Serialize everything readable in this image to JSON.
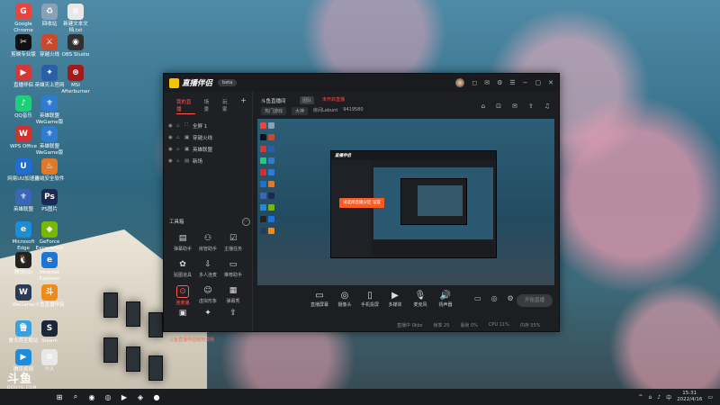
{
  "desktop": {
    "icons": [
      {
        "label": "Google Chrome",
        "color": "#e8453c",
        "glyph": "G"
      },
      {
        "label": "回收站",
        "color": "#8aa0b4",
        "glyph": "♻"
      },
      {
        "label": "新建文本文档.txt",
        "color": "#e8e8e8",
        "glyph": "≡"
      },
      {
        "label": "剪映专业版",
        "color": "#111111",
        "glyph": "✂"
      },
      {
        "label": "穿越火线",
        "color": "#c94a2a",
        "glyph": "⚔"
      },
      {
        "label": "OBS Studio",
        "color": "#303030",
        "glyph": "◉"
      },
      {
        "label": "直播伴侣",
        "color": "#d23a3a",
        "glyph": "▶"
      },
      {
        "label": "英雄天上官网",
        "color": "#2a5fa8",
        "glyph": "✦"
      },
      {
        "label": "MSI Afterburner",
        "color": "#a31a1a",
        "glyph": "⊛"
      },
      {
        "label": "QQ音乐",
        "color": "#1ecf7a",
        "glyph": "♪"
      },
      {
        "label": "英雄联盟 WeGame版",
        "color": "#2f7bd0",
        "glyph": "⚜"
      },
      {
        "label": "WPS Office",
        "color": "#d0312d",
        "glyph": "W"
      },
      {
        "label": "英雄联盟 WeGame版",
        "color": "#2f7bd0",
        "glyph": "⚜"
      },
      {
        "label": "网易UU加速器",
        "color": "#1f6dd6",
        "glyph": "U"
      },
      {
        "label": "火绒安全软件",
        "color": "#e07a2a",
        "glyph": "♨"
      },
      {
        "label": "英雄联盟",
        "color": "#3a66b8",
        "glyph": "⚜"
      },
      {
        "label": "PS图片",
        "color": "#1a2a55",
        "glyph": "Ps"
      },
      {
        "label": "Microsoft Edge",
        "color": "#1a8fd8",
        "glyph": "e"
      },
      {
        "label": "GeForce Experience",
        "color": "#76b900",
        "glyph": "◆"
      },
      {
        "label": "腾讯QQ",
        "color": "#222222",
        "glyph": "🐧"
      },
      {
        "label": "Internet Explorer",
        "color": "#1b74d6",
        "glyph": "e"
      },
      {
        "label": "WeGame",
        "color": "#2a3b58",
        "glyph": "W"
      },
      {
        "label": "斗鱼直播伴侣",
        "color": "#f08a1a",
        "glyph": "斗"
      },
      {
        "label": "鲁大师主题站",
        "color": "#3aa0e0",
        "glyph": "鲁"
      },
      {
        "label": "Steam",
        "color": "#1b2838",
        "glyph": "S"
      },
      {
        "label": "腾讯视频",
        "color": "#1b8de0",
        "glyph": "▶"
      },
      {
        "label": "个人",
        "color": "#e8e8e8",
        "glyph": "≡"
      }
    ]
  },
  "app": {
    "logo": "直播伴侣",
    "version": "beta",
    "left_tabs": [
      "我的直播",
      "场景",
      "玩家"
    ],
    "scenes": [
      {
        "label": "全屏 1"
      },
      {
        "label": "穿越火线"
      },
      {
        "label": "英雄联盟"
      },
      {
        "label": "新场"
      }
    ],
    "tools_title": "工具箱",
    "tools": [
      {
        "label": "弹幕助手",
        "glyph": "▤"
      },
      {
        "label": "房管助手",
        "glyph": "⚇"
      },
      {
        "label": "主播任务",
        "glyph": "☑"
      },
      {
        "label": "贴图道具",
        "glyph": "✿"
      },
      {
        "label": "多人连麦",
        "glyph": "⇩"
      },
      {
        "label": "推荐助手",
        "glyph": "▭"
      },
      {
        "label": "连麦播",
        "glyph": "⊙"
      },
      {
        "label": "虚拟形象",
        "glyph": "☺"
      },
      {
        "label": "弹幕秀",
        "glyph": "▦"
      },
      {
        "label": "",
        "glyph": "▣"
      },
      {
        "label": "",
        "glyph": "✦"
      },
      {
        "label": "",
        "glyph": "⇪"
      }
    ],
    "notice": "斗鱼直播伴侣使用说明",
    "room": {
      "title": "斗鱼直播间",
      "badge": "团队",
      "warning": "未开启直播",
      "category": "热门游戏",
      "level": "大神",
      "room_label": "房间Lebunt",
      "room_id": "9419580"
    },
    "preview_overlay": "请选择直播分区",
    "preview_overlay_btn": "设置",
    "toolbar": [
      {
        "label": "直播屏幕",
        "glyph": "▭"
      },
      {
        "label": "摄像头",
        "glyph": "◎"
      },
      {
        "label": "手机投屏",
        "glyph": "▯"
      },
      {
        "label": "多媒体",
        "glyph": "▶"
      },
      {
        "label": "麦克风",
        "glyph": "🎙"
      },
      {
        "label": "扬声器",
        "glyph": "🔊"
      }
    ],
    "start_button": "开始直播",
    "status": [
      "直播中 0kbs",
      "帧率 25",
      "丢帧 0%",
      "CPU 11%",
      "内存 55%",
      "帧率 25 FPS"
    ]
  },
  "taskbar": {
    "time": "15:31",
    "date": "2022/4/16"
  },
  "watermark": {
    "brand": "斗鱼",
    "url": "DOUYU.COM"
  }
}
